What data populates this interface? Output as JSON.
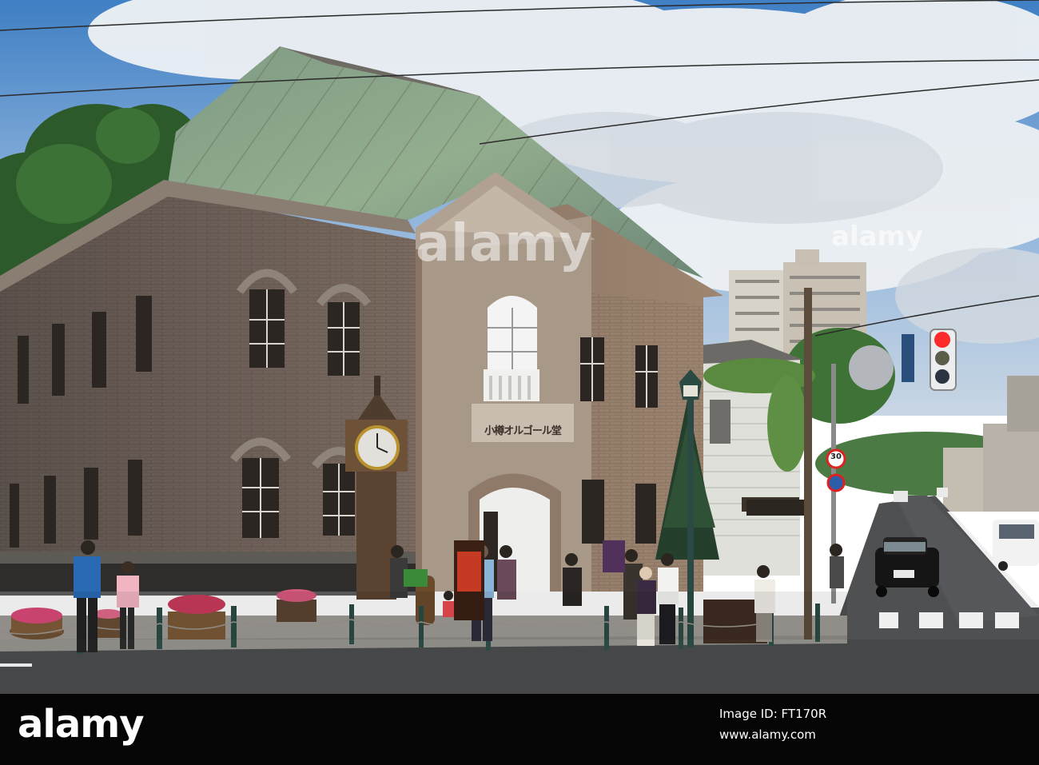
{
  "building_sign": "小樽オルゴール堂",
  "speed_limit": "30",
  "watermark": "alamy",
  "footer": {
    "logo": "alamy",
    "image_id_label": "Image ID: FT170R",
    "website": "www.alamy.com"
  }
}
